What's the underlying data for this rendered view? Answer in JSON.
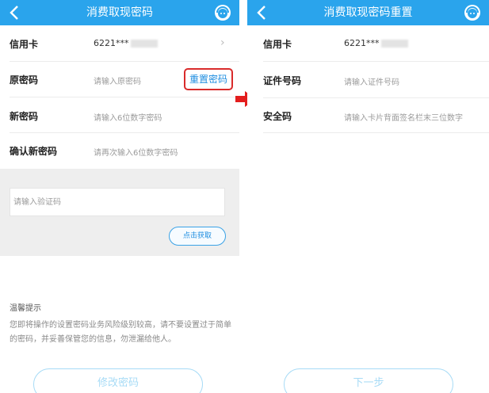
{
  "left": {
    "title": "消费取现密码",
    "rows": [
      {
        "label": "信用卡",
        "value": "6221***",
        "chevron": "›"
      },
      {
        "label": "原密码",
        "placeholder": "请输入原密码",
        "link": "重置密码"
      },
      {
        "label": "新密码",
        "placeholder": "请输入6位数字密码"
      },
      {
        "label": "确认新密码",
        "placeholder": "请再次输入6位数字密码"
      }
    ],
    "captcha_placeholder": "请输入验证码",
    "captcha_button": "点击获取",
    "tip_title": "温馨提示",
    "tip_text": "您即将操作的设置密码业务风险级别较高，请不要设置过于简单的密码，并妥善保管您的信息，勿泄漏给他人。",
    "submit": "修改密码"
  },
  "right": {
    "title": "消费取现密码重置",
    "rows": [
      {
        "label": "信用卡",
        "value": "6221***"
      },
      {
        "label": "证件号码",
        "placeholder": "请输入证件号码"
      },
      {
        "label": "安全码",
        "placeholder": "请输入卡片背面签名栏末三位数字"
      }
    ],
    "next": "下一步"
  },
  "colors": {
    "nav": "#2aa4ec",
    "highlight_border": "#d92b2b",
    "link": "#1f8ee0",
    "arrow": "#e31d1d"
  },
  "icons": {
    "back": "chevron-left-icon",
    "service": "customer-service-icon",
    "arrow": "right-arrow-icon"
  }
}
